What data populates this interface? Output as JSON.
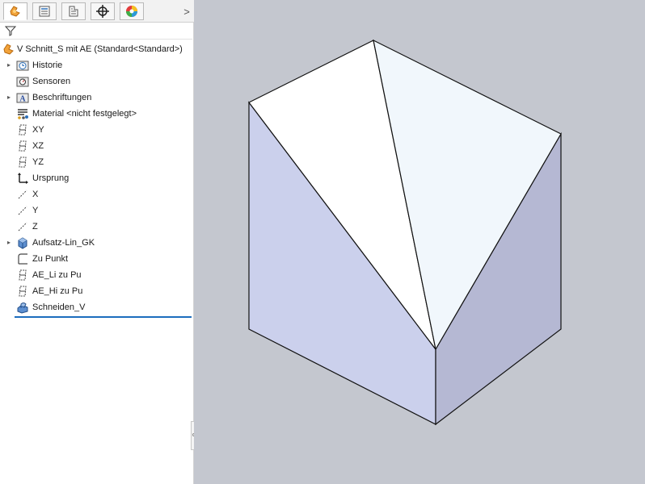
{
  "feature_tree": {
    "root_label": "V Schnitt_S mit AE  (Standard<Standard>)",
    "items": [
      {
        "label": "Historie",
        "icon": "history-folder-icon",
        "expandable": true
      },
      {
        "label": "Sensoren",
        "icon": "sensors-icon",
        "expandable": false
      },
      {
        "label": "Beschriftungen",
        "icon": "annotations-icon",
        "expandable": true
      },
      {
        "label": "Material <nicht festgelegt>",
        "icon": "material-icon",
        "expandable": false
      },
      {
        "label": "XY",
        "icon": "plane-icon",
        "expandable": false
      },
      {
        "label": "XZ",
        "icon": "plane-icon",
        "expandable": false
      },
      {
        "label": "YZ",
        "icon": "plane-icon",
        "expandable": false
      },
      {
        "label": "Ursprung",
        "icon": "origin-icon",
        "expandable": false
      },
      {
        "label": "X",
        "icon": "axis-icon",
        "expandable": false
      },
      {
        "label": "Y",
        "icon": "axis-icon",
        "expandable": false
      },
      {
        "label": "Z",
        "icon": "axis-icon",
        "expandable": false
      },
      {
        "label": "Aufsatz-Lin_GK",
        "icon": "extrude-feature-icon",
        "expandable": true
      },
      {
        "label": "Zu Punkt",
        "icon": "sketch-icon",
        "expandable": false
      },
      {
        "label": "AE_Li zu Pu",
        "icon": "plane-icon",
        "expandable": false
      },
      {
        "label": "AE_Hi zu Pu",
        "icon": "plane-icon",
        "expandable": false
      },
      {
        "label": "Schneiden_V",
        "icon": "cut-feature-icon",
        "expandable": false
      }
    ]
  },
  "tabs": [
    {
      "name": "feature-manager-tab",
      "icon": "feature-manager-icon",
      "active": true
    },
    {
      "name": "property-manager-tab",
      "icon": "property-manager-icon",
      "active": false
    },
    {
      "name": "configuration-manager-tab",
      "icon": "configuration-manager-icon",
      "active": false
    },
    {
      "name": "dimxpert-tab",
      "icon": "dimxpert-icon",
      "active": false
    },
    {
      "name": "display-manager-tab",
      "icon": "display-manager-icon",
      "active": false
    }
  ],
  "tab_overflow_glyph": ">",
  "colors": {
    "viewport_bg": "#c4c7cf",
    "face_left": "#cbd0ec",
    "face_right": "#b5b8d3",
    "face_top_left": "#ffffff",
    "face_top_right": "#f1f7fc",
    "accent": "#1c6dbe"
  }
}
